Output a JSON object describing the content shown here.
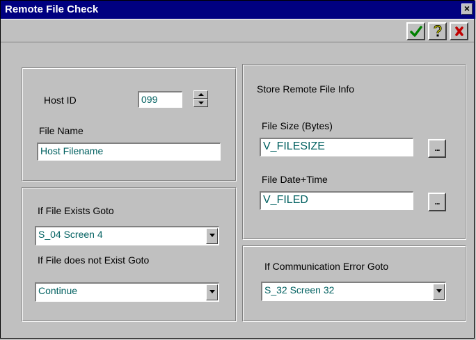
{
  "window": {
    "title": "Remote File Check",
    "close_glyph": "×"
  },
  "toolbar": {
    "ok": {
      "icon": "checkmark-icon",
      "color": "#008000"
    },
    "help": {
      "icon": "question-icon",
      "color": "#808000"
    },
    "cancel": {
      "icon": "x-icon",
      "color": "#c00000"
    }
  },
  "host_panel": {
    "host_id_label": "Host ID",
    "host_id_value": "099",
    "file_name_label": "File Name",
    "file_name_value": "Host Filename"
  },
  "exists_panel": {
    "exists_label": "If File Exists Goto",
    "exists_value": "S_04  Screen 4",
    "not_exists_label": "If File does not Exist Goto",
    "not_exists_value": "Continue"
  },
  "store_panel": {
    "title": "Store Remote File Info",
    "size_label": "File Size (Bytes)",
    "size_value": "V_FILESIZE",
    "date_label": "File Date+Time",
    "date_value": "V_FILED",
    "browse_label": "..."
  },
  "comm_panel": {
    "label": "If Communication Error Goto",
    "value": "S_32  Screen 32"
  }
}
